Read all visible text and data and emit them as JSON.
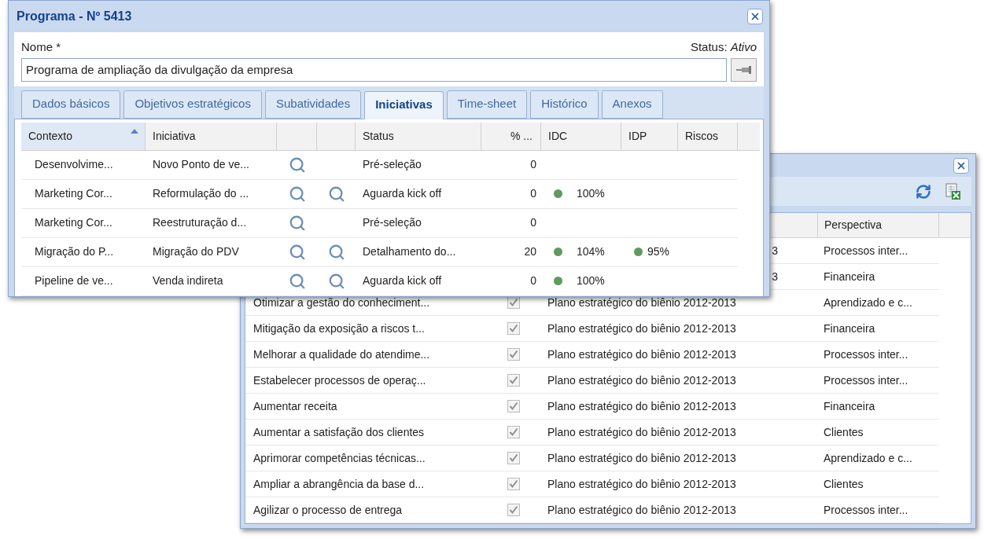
{
  "front_window": {
    "title": "Programa - Nº 5413",
    "name_label": "Nome *",
    "status_label": "Status:",
    "status_value": "Ativo",
    "name_value": "Programa de ampliação da divulgação da empresa",
    "tabs": [
      {
        "label": "Dados básicos",
        "selected": false
      },
      {
        "label": "Objetivos estratégicos",
        "selected": false
      },
      {
        "label": "Subatividades",
        "selected": false
      },
      {
        "label": "Iniciativas",
        "selected": true
      },
      {
        "label": "Time-sheet",
        "selected": false
      },
      {
        "label": "Histórico",
        "selected": false
      },
      {
        "label": "Anexos",
        "selected": false
      }
    ],
    "columns": [
      {
        "label": "Contexto",
        "sorted": true
      },
      {
        "label": "Iniciativa",
        "sorted": false
      },
      {
        "sorted": false
      },
      {
        "sorted": false
      },
      {
        "label": "Status",
        "sorted": false
      },
      {
        "label": "% ...",
        "sorted": false
      },
      {
        "label": "IDC",
        "sorted": false
      },
      {
        "label": "IDP",
        "sorted": false
      },
      {
        "label": "Riscos",
        "sorted": false
      }
    ],
    "rows": [
      {
        "contexto": "Desenvolvime...",
        "iniciativa": "Novo Ponto de ve...",
        "search_1": true,
        "search_2": false,
        "status": "Pré-seleção",
        "percent": "0"
      },
      {
        "contexto": "Marketing Cor...",
        "iniciativa": "Reformulação do ...",
        "search_1": true,
        "search_2": true,
        "status": "Aguarda kick off",
        "percent": "0",
        "idc": {
          "value": "100%",
          "color": "#5f9b5f"
        }
      },
      {
        "contexto": "Marketing Cor...",
        "iniciativa": "Reestruturação d...",
        "search_1": true,
        "search_2": false,
        "status": "Pré-seleção",
        "percent": "0"
      },
      {
        "contexto": "Migração do P...",
        "iniciativa": "Migração do PDV",
        "search_1": true,
        "search_2": true,
        "status": "Detalhamento do...",
        "percent": "20",
        "idc": {
          "value": "104%",
          "color": "#5f9b5f"
        },
        "idp": {
          "value": "95%",
          "color": "#5f9b5f"
        }
      },
      {
        "contexto": "Pipeline de ve...",
        "iniciativa": "Venda indireta",
        "search_1": true,
        "search_2": true,
        "status": "Aguarda kick off",
        "percent": "0",
        "idc": {
          "value": "100%",
          "color": "#5f9b5f"
        }
      }
    ]
  },
  "back_window": {
    "columns": [
      {
        "label": "Perspectiva"
      }
    ],
    "rows": [
      {
        "plan": "3",
        "perspectiva": "Processos inter..."
      },
      {
        "plan": "3",
        "perspectiva": "Financeira"
      },
      {
        "objetivo": "Otimizar a gestão do conheciment...",
        "checked": true,
        "disabled": true,
        "plan": "Plano estratégico do biênio 2012-2013",
        "perspectiva": "Aprendizado e c..."
      },
      {
        "objetivo": "Mitigação da exposição a riscos t...",
        "checked": true,
        "disabled": true,
        "plan": "Plano estratégico do biênio 2012-2013",
        "perspectiva": "Financeira"
      },
      {
        "objetivo": "Melhorar a qualidade do atendime...",
        "checked": true,
        "disabled": true,
        "plan": "Plano estratégico do biênio 2012-2013",
        "perspectiva": "Processos inter..."
      },
      {
        "objetivo": "Estabelecer processos de operaç...",
        "checked": true,
        "disabled": true,
        "plan": "Plano estratégico do biênio 2012-2013",
        "perspectiva": "Processos inter..."
      },
      {
        "objetivo": "Aumentar receita",
        "checked": true,
        "disabled": true,
        "plan": "Plano estratégico do biênio 2012-2013",
        "perspectiva": "Financeira"
      },
      {
        "objetivo": "Aumentar a satisfação dos clientes",
        "checked": true,
        "disabled": true,
        "plan": "Plano estratégico do biênio 2012-2013",
        "perspectiva": "Clientes"
      },
      {
        "objetivo": "Aprimorar competências técnicas...",
        "checked": true,
        "disabled": true,
        "plan": "Plano estratégico do biênio 2012-2013",
        "perspectiva": "Aprendizado e c..."
      },
      {
        "objetivo": "Ampliar a abrangência da base d...",
        "checked": true,
        "disabled": true,
        "plan": "Plano estratégico do biênio 2012-2013",
        "perspectiva": "Clientes"
      },
      {
        "objetivo": "Agilizar o processo de entrega",
        "checked": true,
        "disabled": true,
        "plan": "Plano estratégico do biênio 2012-2013",
        "perspectiva": "Processos inter..."
      }
    ]
  }
}
